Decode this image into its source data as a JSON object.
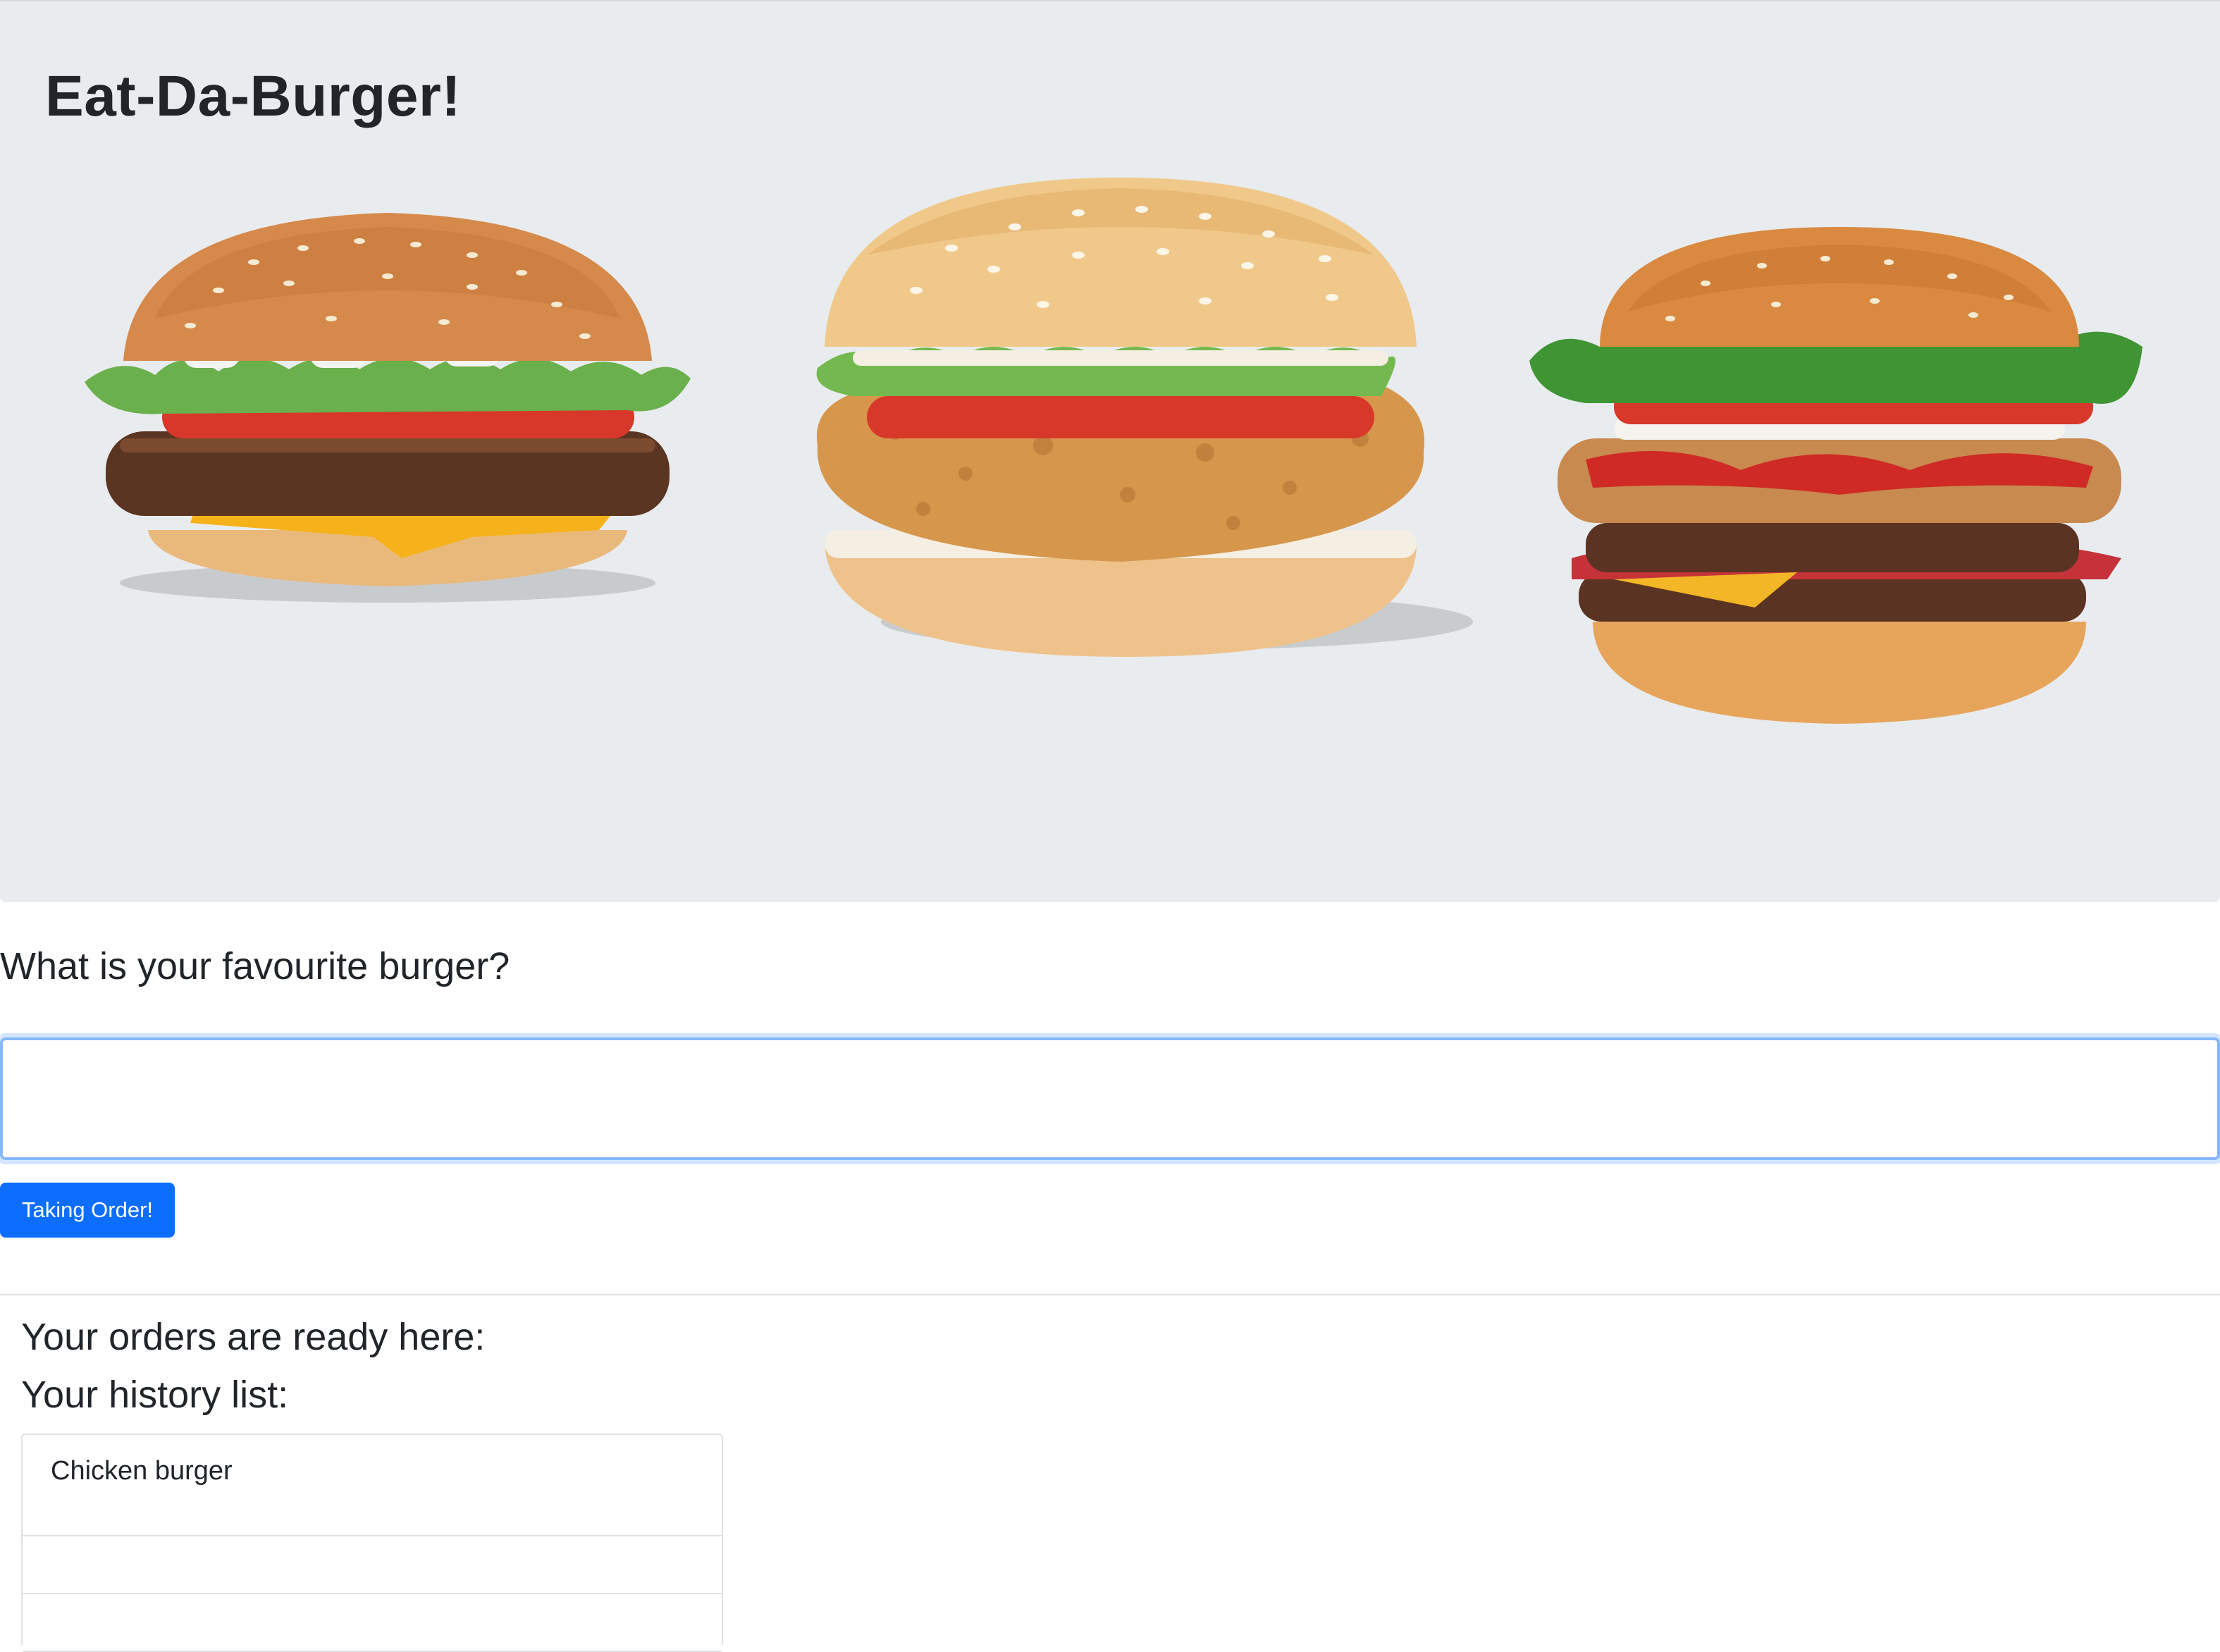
{
  "header": {
    "title": "Eat-Da-Burger!"
  },
  "gallery": {
    "images": [
      {
        "alt": "Beef burger with cheese"
      },
      {
        "alt": "Crispy chicken burger"
      },
      {
        "alt": "Double burger with bacon"
      }
    ]
  },
  "form": {
    "question": "What is your favourite burger?",
    "input_value": "",
    "input_placeholder": "",
    "submit_label": "Taking Order!"
  },
  "orders": {
    "ready_heading": "Your orders are ready here:",
    "history_heading": "Your history list:",
    "history_items": [
      "Chicken burger",
      "",
      ""
    ]
  },
  "colors": {
    "hero_background": "#e9ecef",
    "accent": "#0d6efd"
  }
}
